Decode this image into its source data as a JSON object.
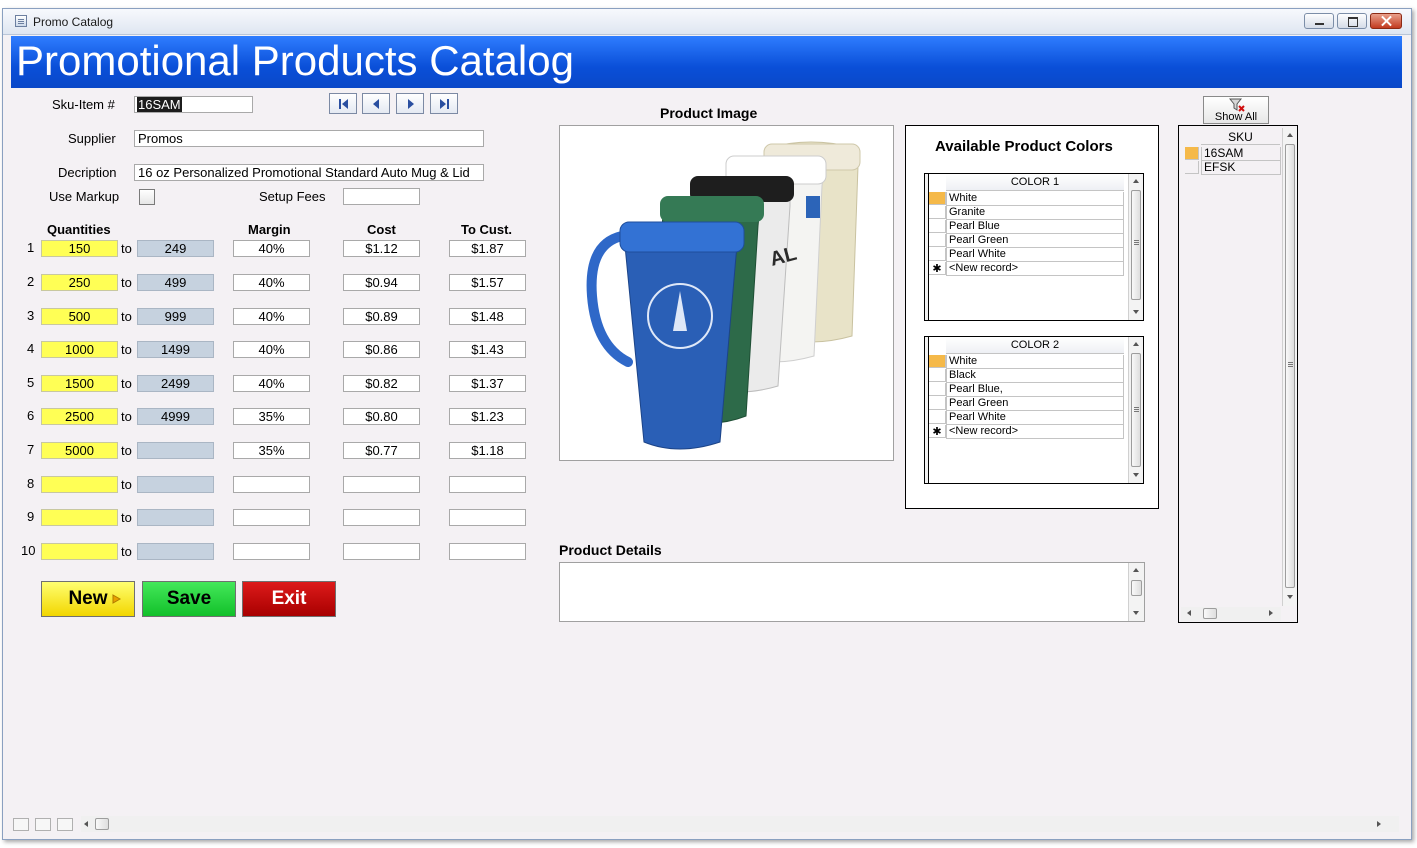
{
  "window": {
    "title": "Promo Catalog"
  },
  "banner": {
    "title": "Promotional Products Catalog"
  },
  "form": {
    "sku_label": "Sku-Item #",
    "sku_value": "16SAM",
    "supplier_label": "Supplier",
    "supplier_value": "Promos",
    "description_label": "Decription",
    "description_value": "16 oz Personalized Promotional Standard Auto Mug & Lid",
    "use_markup_label": "Use Markup",
    "use_markup_checked": false,
    "setup_fees_label": "Setup Fees",
    "setup_fees_value": ""
  },
  "pricing": {
    "headers": {
      "quantities": "Quantities",
      "margin": "Margin",
      "cost": "Cost",
      "to_cust": "To Cust."
    },
    "to_label": "to",
    "rows": [
      {
        "num": "1",
        "from": "150",
        "to": "249",
        "margin": "40%",
        "cost": "$1.12",
        "to_cust": "$1.87"
      },
      {
        "num": "2",
        "from": "250",
        "to": "499",
        "margin": "40%",
        "cost": "$0.94",
        "to_cust": "$1.57"
      },
      {
        "num": "3",
        "from": "500",
        "to": "999",
        "margin": "40%",
        "cost": "$0.89",
        "to_cust": "$1.48"
      },
      {
        "num": "4",
        "from": "1000",
        "to": "1499",
        "margin": "40%",
        "cost": "$0.86",
        "to_cust": "$1.43"
      },
      {
        "num": "5",
        "from": "1500",
        "to": "2499",
        "margin": "40%",
        "cost": "$0.82",
        "to_cust": "$1.37"
      },
      {
        "num": "6",
        "from": "2500",
        "to": "4999",
        "margin": "35%",
        "cost": "$0.80",
        "to_cust": "$1.23"
      },
      {
        "num": "7",
        "from": "5000",
        "to": "",
        "margin": "35%",
        "cost": "$0.77",
        "to_cust": "$1.18"
      },
      {
        "num": "8",
        "from": "",
        "to": "",
        "margin": "",
        "cost": "",
        "to_cust": ""
      },
      {
        "num": "9",
        "from": "",
        "to": "",
        "margin": "",
        "cost": "",
        "to_cust": ""
      },
      {
        "num": "10",
        "from": "",
        "to": "",
        "margin": "",
        "cost": "",
        "to_cust": ""
      }
    ]
  },
  "buttons": {
    "new": "New",
    "save": "Save",
    "exit": "Exit"
  },
  "image_section": {
    "title": "Product Image"
  },
  "details_section": {
    "title": "Product Details",
    "value": ""
  },
  "colors": {
    "title": "Available Product Colors",
    "color1": {
      "header": "COLOR 1",
      "rows": [
        "White",
        "Granite",
        "Pearl Blue",
        "Pearl Green",
        "Pearl White"
      ],
      "new_record": "<New record>"
    },
    "color2": {
      "header": "COLOR 2",
      "rows": [
        "White",
        "Black",
        "Pearl Blue,",
        "Pearl Green",
        "Pearl White"
      ],
      "new_record": "<New record>"
    }
  },
  "sku_list": {
    "show_all": "Show All",
    "header": "SKU",
    "rows": [
      "16SAM",
      "EFSK"
    ]
  },
  "theme": {
    "banner_blue": "#0a4fd8",
    "qty_yellow": "#ffff55",
    "qty_grey": "#c6d2df",
    "new_yellow": "#f2d600",
    "save_green": "#12c02a",
    "exit_red": "#a80000",
    "record_marker": "#f5b949"
  },
  "icons": [
    "app-icon",
    "minimize-icon",
    "maximize-icon",
    "close-icon",
    "first-record-icon",
    "previous-record-icon",
    "next-record-icon",
    "last-record-icon",
    "show-all-filter-icon",
    "new-record-star-icon"
  ]
}
